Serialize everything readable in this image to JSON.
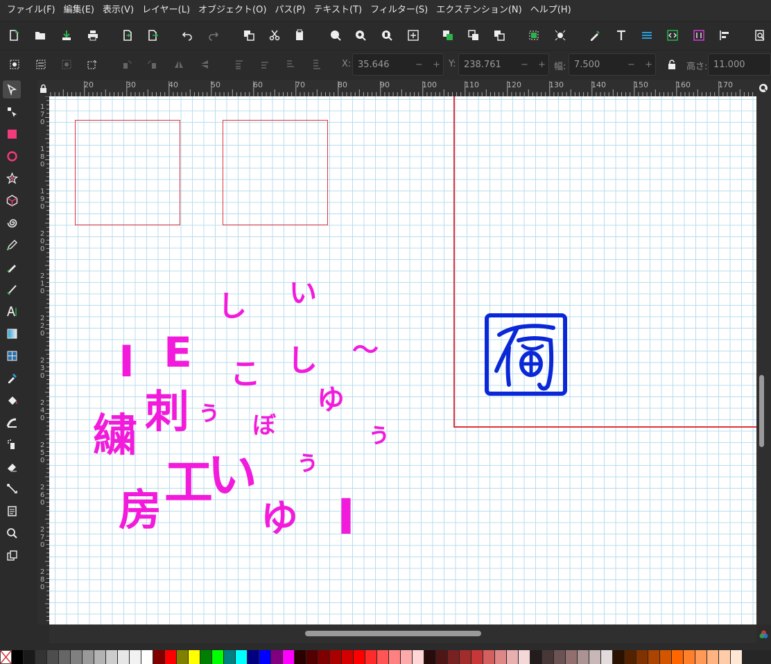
{
  "menubar": {
    "items": [
      "ファイル(F)",
      "編集(E)",
      "表示(V)",
      "レイヤー(L)",
      "オブジェクト(O)",
      "パス(P)",
      "テキスト(T)",
      "フィルター(S)",
      "エクステンション(N)",
      "ヘルプ(H)"
    ]
  },
  "toolcontrols": {
    "x_label": "X:",
    "x_value": "35.646",
    "y_label": "Y:",
    "y_value": "238.761",
    "w_label": "幅:",
    "w_value": "7.500",
    "h_label": "高さ:",
    "h_value": "11.000"
  },
  "ruler": {
    "h_labels": [
      "20",
      "30",
      "40",
      "50",
      "60",
      "70",
      "80",
      "90",
      "100",
      "110",
      "120",
      "130",
      "140",
      "150",
      "160",
      "170"
    ],
    "v_labels": [
      "1\n7\n0",
      "1\n8\n0",
      "1\n9\n0",
      "2\n0\n0",
      "2\n1\n0",
      "2\n2\n0",
      "2\n3\n0",
      "2\n4\n0",
      "2\n5\n0",
      "2\n6\n0",
      "2\n7\n0",
      "2\n8\n0"
    ]
  },
  "canvas": {
    "glyph_color": "#f21bdc",
    "seal_color": "#0a28d8",
    "outline_color": "#e0303a",
    "glyphs": [
      {
        "text": "い",
        "size": 40
      },
      {
        "text": "し",
        "size": 42
      },
      {
        "text": "E",
        "size": 60
      },
      {
        "text": "〜",
        "size": 38
      },
      {
        "text": "I",
        "size": 62
      },
      {
        "text": "こ",
        "size": 44
      },
      {
        "text": "し",
        "size": 44
      },
      {
        "text": "ゆ",
        "size": 40
      },
      {
        "text": "刺",
        "size": 64
      },
      {
        "text": "ぅ",
        "size": 36
      },
      {
        "text": "ぼ",
        "size": 34
      },
      {
        "text": "ぅ",
        "size": 36
      },
      {
        "text": "繍",
        "size": 64
      },
      {
        "text": "ぅ",
        "size": 36
      },
      {
        "text": "工",
        "size": 70
      },
      {
        "text": "い",
        "size": 72
      },
      {
        "text": "房",
        "size": 62
      },
      {
        "text": "ゆ",
        "size": 54
      },
      {
        "text": "I",
        "size": 70
      }
    ]
  },
  "palette": {
    "colors": [
      "#000000",
      "#1a1a1a",
      "#333333",
      "#4d4d4d",
      "#666666",
      "#808080",
      "#999999",
      "#b3b3b3",
      "#cccccc",
      "#e6e6e6",
      "#f2f2f2",
      "#ffffff",
      "#800000",
      "#ff0000",
      "#808000",
      "#ffff00",
      "#008000",
      "#00ff00",
      "#008080",
      "#00ffff",
      "#000080",
      "#0000ff",
      "#800080",
      "#ff00ff",
      "#2b0000",
      "#550000",
      "#800000",
      "#aa0000",
      "#d40000",
      "#ff0000",
      "#ff2a2a",
      "#ff5555",
      "#ff8080",
      "#ffaaaa",
      "#ffd5d5",
      "#280b0b",
      "#501616",
      "#782121",
      "#a02c2c",
      "#c83737",
      "#d35f5f",
      "#de8787",
      "#e9afaf",
      "#f4d7d7",
      "#241c1c",
      "#483737",
      "#6c5353",
      "#916f6f",
      "#ac9393",
      "#c8b7b7",
      "#e3dbdb",
      "#2b1100",
      "#552200",
      "#803300",
      "#aa4400",
      "#d45500",
      "#ff6600",
      "#ff7f2a",
      "#ff9955",
      "#ffb380",
      "#ffccaa",
      "#ffe6d5"
    ]
  }
}
